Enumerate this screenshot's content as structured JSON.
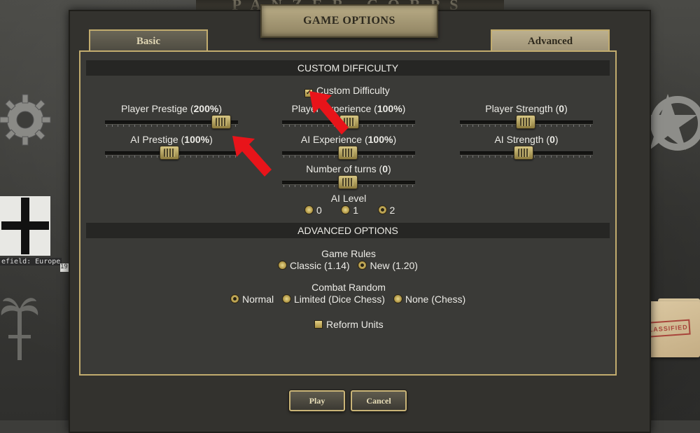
{
  "window": {
    "title": "GAME OPTIONS",
    "banner_text": "PANZER CORPS"
  },
  "tabs": [
    {
      "label": "Basic",
      "active": false
    },
    {
      "label": "Advanced",
      "active": true
    }
  ],
  "sections": {
    "custom_difficulty": "CUSTOM DIFFICULTY",
    "advanced_options": "ADVANCED OPTIONS"
  },
  "custom_difficulty_checkbox": {
    "label": "Custom Difficulty",
    "checked": true
  },
  "sliders": {
    "player_prestige": {
      "label": "Player Prestige",
      "value": "200%",
      "position": 0.8
    },
    "player_experience": {
      "label": "Player Experience",
      "value": "100%",
      "position": 0.5
    },
    "player_strength": {
      "label": "Player Strength",
      "value": "0",
      "position": 0.5
    },
    "ai_prestige": {
      "label": "AI Prestige",
      "value": "100%",
      "position": 0.5
    },
    "ai_experience": {
      "label": "AI Experience",
      "value": "100%",
      "position": 0.5
    },
    "ai_strength": {
      "label": "AI Strength",
      "value": "0",
      "position": 0.5
    },
    "number_of_turns": {
      "label": "Number of turns",
      "value": "0",
      "position": 0.5
    }
  },
  "ai_level": {
    "label": "AI Level",
    "options": [
      "0",
      "1",
      "2"
    ],
    "selected": "2"
  },
  "game_rules": {
    "label": "Game Rules",
    "options": [
      "Classic (1.14)",
      "New (1.20)"
    ],
    "selected": "New (1.20)"
  },
  "combat_random": {
    "label": "Combat Random",
    "options": [
      "Normal",
      "Limited (Dice Chess)",
      "None (Chess)"
    ],
    "selected": "Normal"
  },
  "reform_units": {
    "label": "Reform Units",
    "checked": false
  },
  "buttons": {
    "play": "Play",
    "cancel": "Cancel"
  },
  "background": {
    "left_label": "efield: Europe",
    "left_label2": "19",
    "folder_stamp": "CLASSIFIED"
  },
  "colors": {
    "accent_gold": "#c2ac6e",
    "arrow_red": "#e8141a"
  }
}
